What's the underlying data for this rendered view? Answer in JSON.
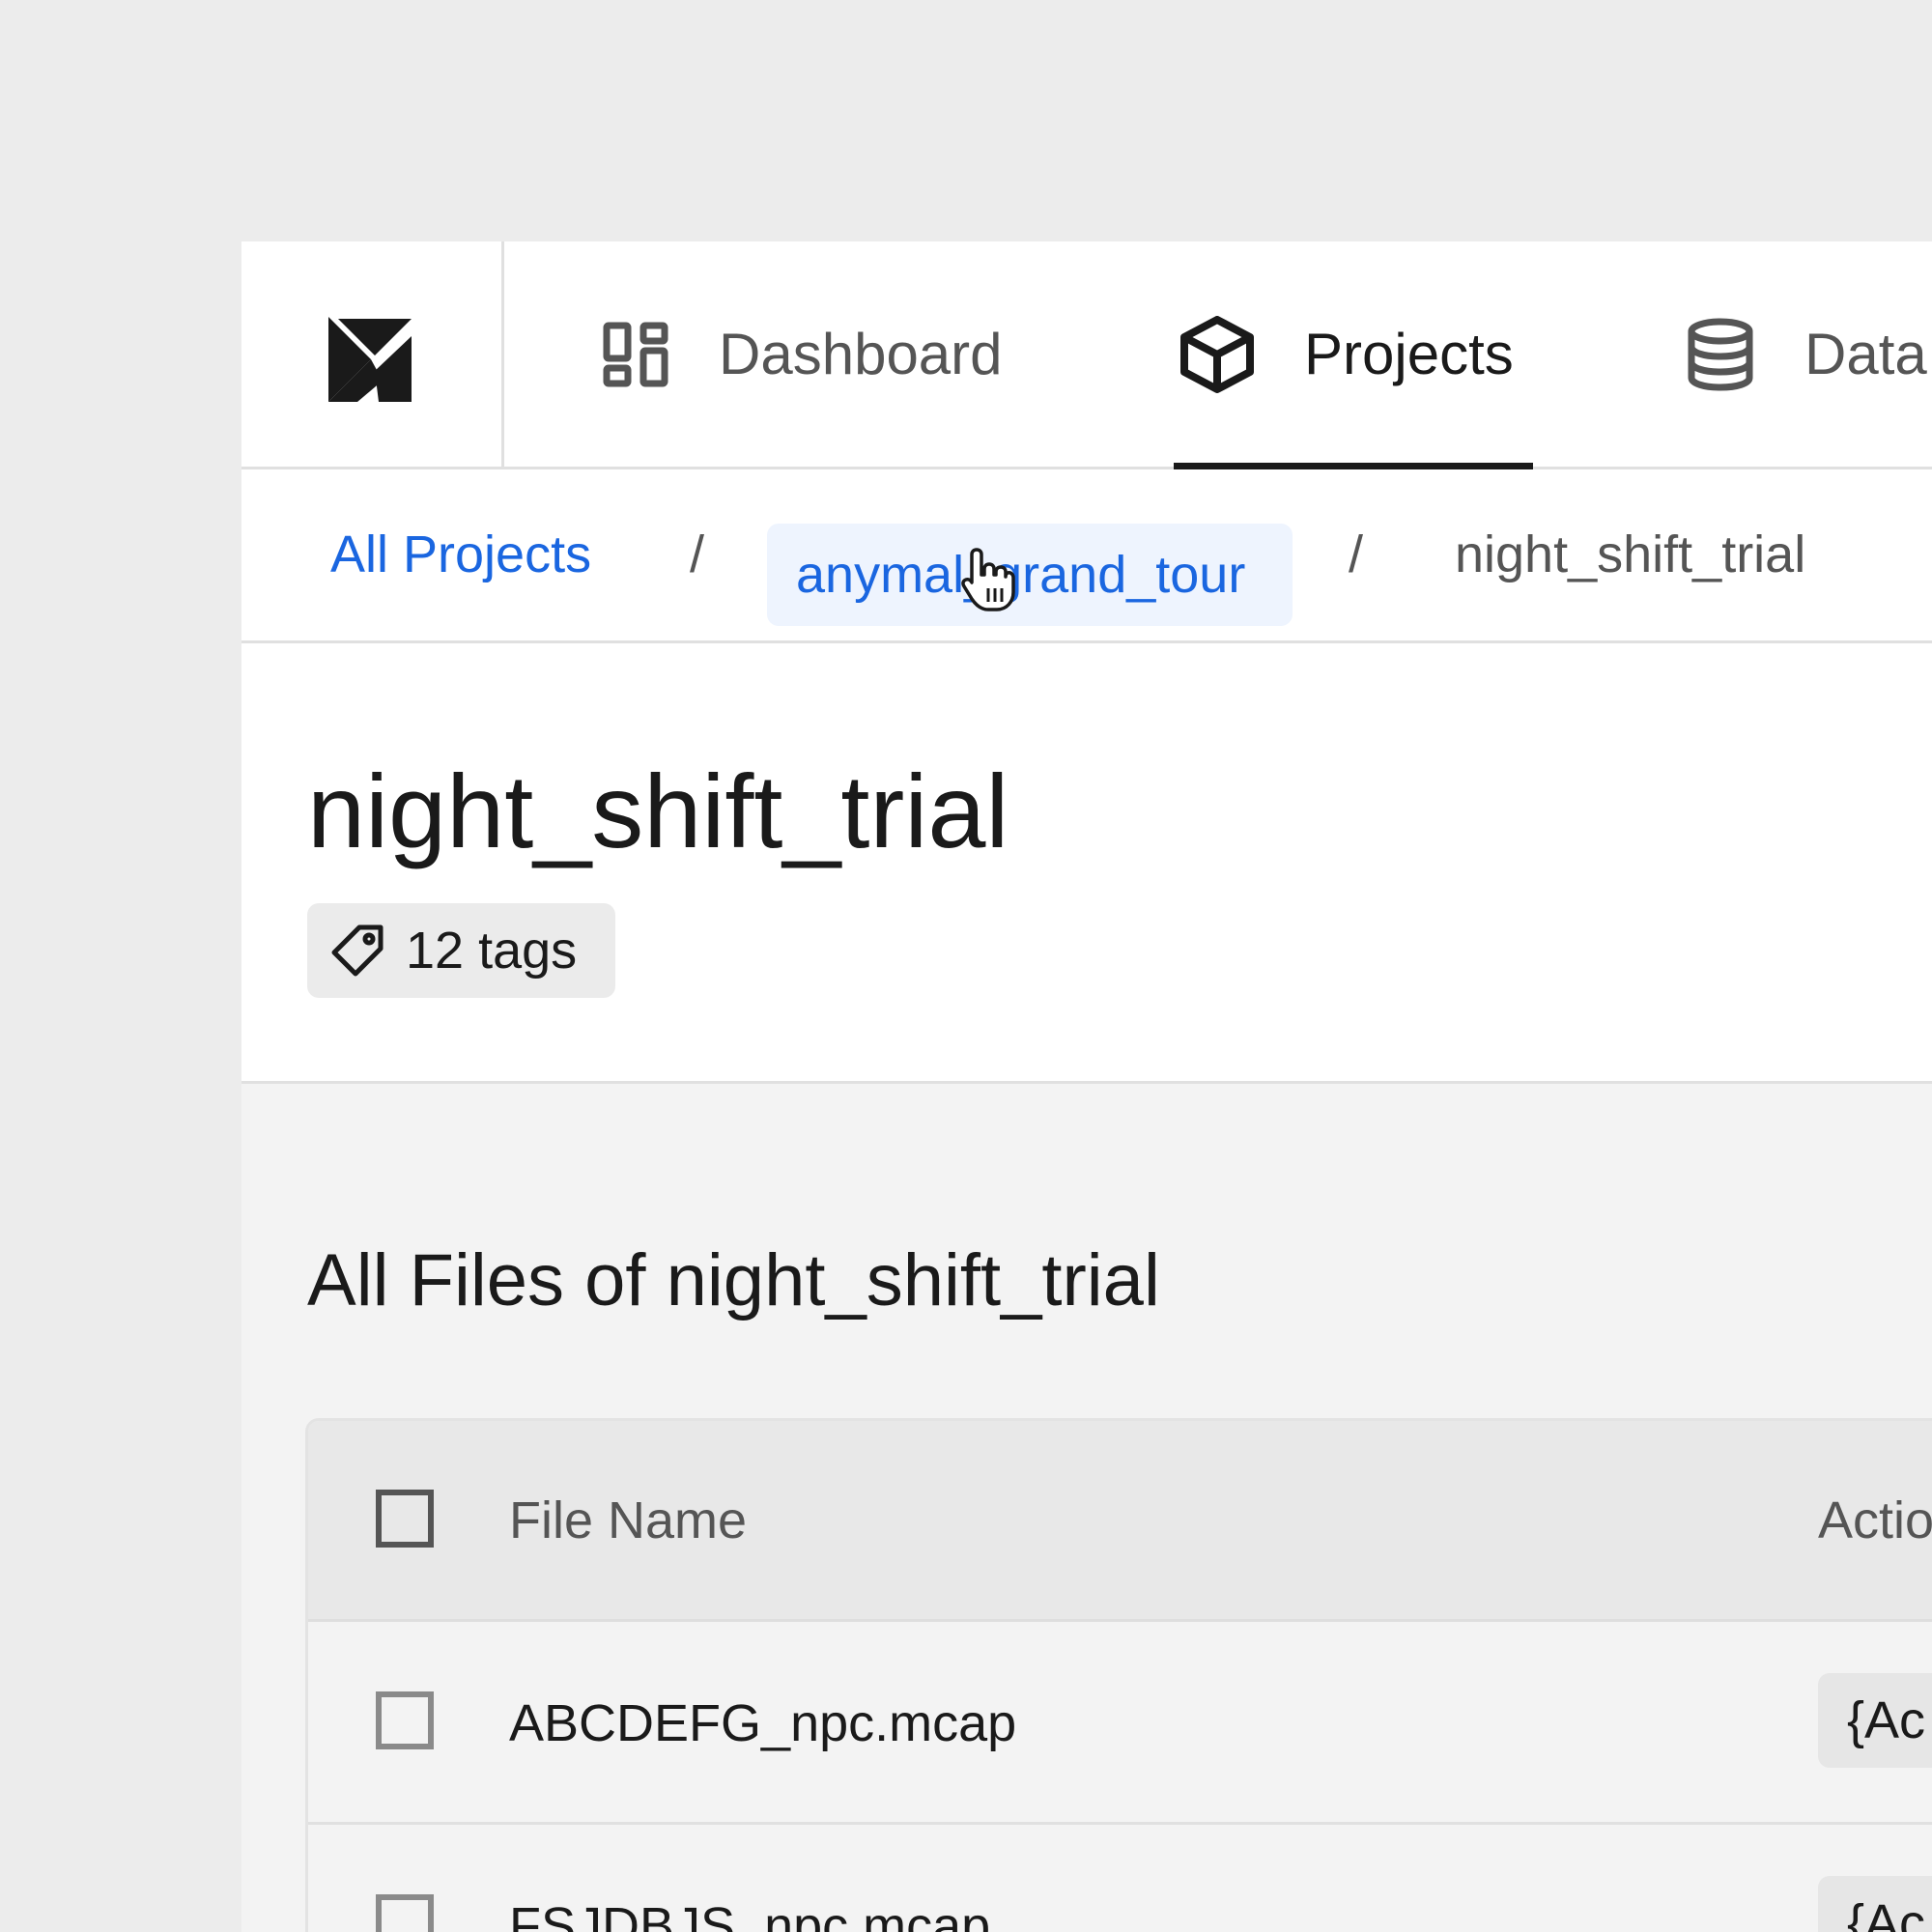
{
  "nav": {
    "items": [
      {
        "label": "Dashboard",
        "icon": "dashboard-icon"
      },
      {
        "label": "Projects",
        "icon": "cube-icon",
        "active": true
      },
      {
        "label": "Data",
        "icon": "database-icon"
      }
    ]
  },
  "breadcrumb": {
    "items": [
      "All Projects",
      "anymal_grand_tour",
      "night_shift_trial"
    ],
    "separator": "/"
  },
  "header": {
    "title": "night_shift_trial",
    "tags_label": "12 tags"
  },
  "files": {
    "title": "All Files of night_shift_trial",
    "columns": [
      "File Name",
      "Actio"
    ],
    "rows": [
      {
        "name": "ABCDEFG_npc.mcap",
        "action": "{Ac"
      },
      {
        "name": "FSJDBJS_npc.mcap",
        "action": "{Ac"
      }
    ]
  },
  "colors": {
    "link": "#1a66e0",
    "text": "#1a1a1a",
    "muted": "#555555",
    "background": "#ececec"
  }
}
